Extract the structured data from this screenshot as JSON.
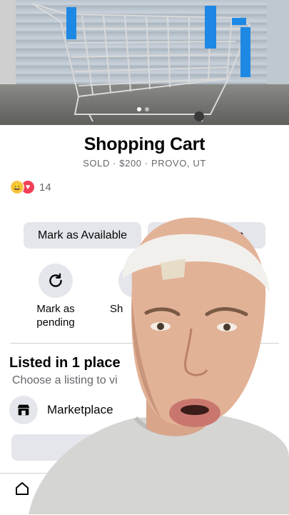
{
  "listing": {
    "title": "Shopping Cart",
    "meta": "SOLD · $200 · PROVO, UT",
    "reaction_count": "14",
    "photo_alt": "shopping cart photo"
  },
  "actions": {
    "mark_available": "Mark as Available",
    "relist": "Relist this item",
    "mark_pending_line1": "Mark as",
    "mark_pending_line2": "pending",
    "share_partial": "Sh"
  },
  "listed": {
    "title": "Listed in 1 place",
    "subtitle": "Choose a listing to vi",
    "marketplace_label": "Marketplace"
  },
  "colors": {
    "button_bg": "#e4e6eb",
    "secondary_text": "#65676b",
    "cart_accent": "#1e88e5"
  }
}
